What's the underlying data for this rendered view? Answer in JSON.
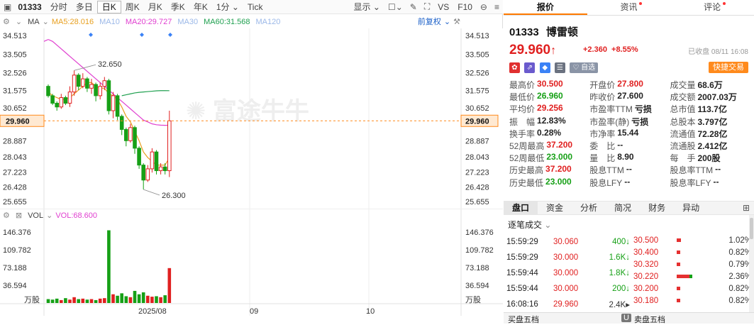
{
  "toolbar": {
    "code": "01333",
    "tabs": [
      "分时",
      "多日",
      "日K",
      "周K",
      "月K",
      "季K",
      "年K",
      "1分 ⌄",
      "Tick"
    ],
    "active_tab": "日K",
    "display": "显示 ⌄",
    "vs": "VS",
    "f10": "F10"
  },
  "ma_bar": {
    "indicator": "MA",
    "ma5": "MA5:28.016",
    "ma10": "MA10",
    "ma20": "MA20:29.727",
    "ma30": "MA30",
    "ma60": "MA60:31.568",
    "ma120": "MA120",
    "adjust": "前复权"
  },
  "vol_bar": {
    "indicator": "VOL",
    "vol": "VOL:68.600"
  },
  "chart_data": {
    "type": "candlestick",
    "price_axis": {
      "labels": [
        "34.513",
        "33.505",
        "32.526",
        "31.575",
        "30.652",
        "28.887",
        "28.043",
        "27.223",
        "26.428",
        "25.655"
      ],
      "current": "29.960"
    },
    "volume_axis": {
      "labels": [
        "146.376",
        "109.782",
        "73.188",
        "36.594"
      ],
      "unit": "万股"
    },
    "x_labels": [
      "2025/08",
      "09",
      "10"
    ],
    "annotations": {
      "high": "32.650",
      "low": "26.300"
    },
    "candles": [
      [
        31.8,
        31.3,
        31.9,
        31.2
      ],
      [
        31.3,
        30.9,
        31.4,
        30.8
      ],
      [
        30.9,
        30.7,
        31.0,
        30.5
      ],
      [
        30.7,
        31.2,
        31.4,
        30.6
      ],
      [
        31.2,
        30.9,
        31.3,
        30.8
      ],
      [
        30.9,
        31.5,
        31.8,
        30.7
      ],
      [
        31.5,
        32.4,
        32.65,
        31.3
      ],
      [
        32.4,
        31.8,
        32.5,
        31.6
      ],
      [
        31.8,
        32.2,
        32.5,
        31.7
      ],
      [
        32.2,
        31.7,
        32.3,
        31.5
      ],
      [
        31.7,
        31.9,
        32.2,
        31.4
      ],
      [
        31.9,
        31.3,
        32.0,
        31.0
      ],
      [
        31.3,
        31.8,
        32.0,
        31.1
      ],
      [
        31.8,
        32.1,
        32.3,
        31.6
      ],
      [
        32.1,
        30.5,
        32.2,
        30.3
      ],
      [
        30.5,
        31.3,
        31.5,
        30.1
      ],
      [
        31.3,
        30.2,
        31.4,
        30.0
      ],
      [
        30.2,
        29.5,
        30.3,
        29.2
      ],
      [
        29.5,
        28.9,
        29.6,
        28.6
      ],
      [
        28.9,
        29.6,
        29.8,
        28.8
      ],
      [
        29.6,
        28.5,
        29.7,
        28.2
      ],
      [
        28.5,
        27.6,
        28.6,
        27.4
      ],
      [
        27.6,
        26.8,
        27.7,
        26.3
      ],
      [
        26.8,
        27.4,
        27.6,
        26.7
      ],
      [
        27.4,
        28.3,
        28.5,
        27.2
      ],
      [
        28.3,
        27.3,
        28.4,
        27.1
      ],
      [
        27.3,
        27.5,
        27.7,
        27.1
      ],
      [
        27.5,
        27.3,
        27.7,
        27.1
      ],
      [
        27.3,
        29.96,
        30.5,
        26.96
      ]
    ],
    "volumes": [
      8,
      7,
      9,
      6,
      10,
      7,
      12,
      8,
      9,
      7,
      8,
      6,
      9,
      10,
      150,
      18,
      15,
      20,
      14,
      12,
      25,
      18,
      22,
      15,
      13,
      14,
      12,
      16,
      72
    ],
    "ma5": [
      31.5,
      31.3,
      31.2,
      31.1,
      31.1,
      31.2,
      31.4,
      31.6,
      31.8,
      32.0,
      32.0,
      31.8,
      31.7,
      31.7,
      31.4,
      31.3,
      31.1,
      30.7,
      30.2,
      29.9,
      29.4,
      28.9,
      28.3,
      28.0,
      27.8,
      27.6,
      27.6,
      27.6,
      28.0
    ],
    "ma20": [
      34.3,
      34.2,
      34.0,
      33.8,
      33.6,
      33.4,
      33.2,
      33.0,
      32.8,
      32.6,
      32.4,
      32.2,
      32.0,
      31.8,
      31.6,
      31.4,
      31.2,
      31.0,
      30.8,
      30.6,
      30.4,
      30.2,
      30.0,
      29.9,
      29.8,
      29.75,
      29.73,
      29.72,
      29.727
    ],
    "ma60": [
      null,
      null,
      null,
      null,
      null,
      null,
      null,
      null,
      null,
      null,
      null,
      null,
      null,
      null,
      null,
      null,
      null,
      31.3,
      31.35,
      31.4,
      31.45,
      31.48,
      31.5,
      31.52,
      31.54,
      31.56,
      31.57,
      31.57,
      31.568
    ]
  },
  "quote": {
    "tabs": [
      "报价",
      "资讯",
      "评论"
    ],
    "code": "01333",
    "name": "博雷顿",
    "price": "29.960",
    "arrow": "↑",
    "change": "+2.360",
    "pct": "+8.55%",
    "timestamp": "已收盘 08/11 16:08",
    "quick_trade": "快捷交易",
    "watch": "自选"
  },
  "stats": [
    [
      {
        "l": "最高价",
        "v": "30.500",
        "c": "red"
      },
      {
        "l": "开盘价",
        "v": "27.800",
        "c": "red"
      },
      {
        "l": "成交量",
        "v": "68.6万",
        "c": ""
      }
    ],
    [
      {
        "l": "最低价",
        "v": "26.960",
        "c": "green"
      },
      {
        "l": "昨收价",
        "v": "27.600",
        "c": ""
      },
      {
        "l": "成交额",
        "v": "2007.03万",
        "c": ""
      }
    ],
    [
      {
        "l": "平均价",
        "v": "29.256",
        "c": "red"
      },
      {
        "l": "市盈率TTM",
        "v": "亏损",
        "c": ""
      },
      {
        "l": "总市值",
        "v": "113.7亿",
        "c": ""
      }
    ],
    [
      {
        "l": "振　幅",
        "v": "12.83%",
        "c": ""
      },
      {
        "l": "市盈率(静)",
        "v": "亏损",
        "c": ""
      },
      {
        "l": "总股本",
        "v": "3.797亿",
        "c": ""
      }
    ],
    [
      {
        "l": "换手率",
        "v": "0.28%",
        "c": ""
      },
      {
        "l": "市净率",
        "v": "15.44",
        "c": ""
      },
      {
        "l": "流通值",
        "v": "72.28亿",
        "c": ""
      }
    ],
    [
      {
        "l": "52周最高",
        "v": "37.200",
        "c": "red"
      },
      {
        "l": "委　比",
        "v": "--",
        "c": ""
      },
      {
        "l": "流通股",
        "v": "2.412亿",
        "c": ""
      }
    ],
    [
      {
        "l": "52周最低",
        "v": "23.000",
        "c": "green"
      },
      {
        "l": "量　比",
        "v": "8.90",
        "c": ""
      },
      {
        "l": "每　手",
        "v": "200股",
        "c": ""
      }
    ],
    [
      {
        "l": "历史最高",
        "v": "37.200",
        "c": "red"
      },
      {
        "l": "股息TTM",
        "v": "--",
        "c": ""
      },
      {
        "l": "股息率TTM",
        "v": "--",
        "c": ""
      }
    ],
    [
      {
        "l": "历史最低",
        "v": "23.000",
        "c": "green"
      },
      {
        "l": "股息LFY",
        "v": "--",
        "c": ""
      },
      {
        "l": "股息率LFY",
        "v": "--",
        "c": ""
      }
    ]
  ],
  "subtabs": [
    "盘口",
    "资金",
    "分析",
    "简况",
    "财务",
    "异动"
  ],
  "tape_title": "逐笔成交",
  "tape": [
    {
      "t": "15:59:29",
      "p": "30.060",
      "v": "400",
      "a": "↓"
    },
    {
      "t": "15:59:29",
      "p": "30.000",
      "v": "1.6K",
      "a": "↓"
    },
    {
      "t": "15:59:44",
      "p": "30.000",
      "v": "1.8K",
      "a": "↓"
    },
    {
      "t": "15:59:44",
      "p": "30.000",
      "v": "200",
      "a": "↓"
    },
    {
      "t": "16:08:16",
      "p": "29.960",
      "v": "2.4K",
      "a": "▸"
    }
  ],
  "levels": [
    {
      "p": "30.500",
      "pct": "1.02%",
      "w": 0.1
    },
    {
      "p": "30.400",
      "pct": "0.82%",
      "w": 0.08
    },
    {
      "p": "30.320",
      "pct": "0.79%",
      "w": 0.08
    },
    {
      "p": "30.220",
      "pct": "2.36%",
      "w": 0.3
    },
    {
      "p": "30.200",
      "pct": "0.82%",
      "w": 0.08
    },
    {
      "p": "30.180",
      "pct": "0.82%",
      "w": 0.08
    }
  ],
  "bottom": {
    "buy5": "买盘五档",
    "sell5": "卖盘五档",
    "badge": "U"
  },
  "colors": {
    "up": "#e02020",
    "down": "#16a016",
    "ma5": "#e8a020",
    "ma20": "#e040d0",
    "ma60": "#20a050",
    "accent": "#ff8a1c"
  }
}
